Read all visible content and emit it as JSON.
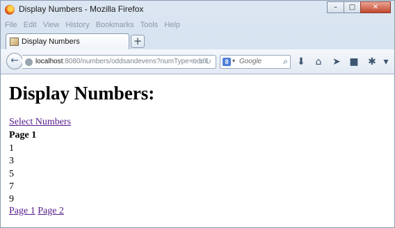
{
  "window": {
    "title": "Display Numbers - Mozilla Firefox",
    "controls": {
      "minimize": "–",
      "maximize": "□",
      "close": "✕"
    }
  },
  "menu": [
    "File",
    "Edit",
    "View",
    "History",
    "Bookmarks",
    "Tools",
    "Help"
  ],
  "tab": {
    "title": "Display Numbers",
    "new_tab": "+"
  },
  "navbar": {
    "back_icon": "←",
    "url_host": "localhost",
    "url_rest": ":8080/numbers/oddsandevens?numType=odds",
    "url_icons": "☆▿↻",
    "search_engine": "8",
    "search_dropdown": "▾",
    "search_placeholder": "Google",
    "search_icon": "⌕",
    "download_icon": "⬇",
    "home_icon": "⌂",
    "send_icon": "➤",
    "pocket_icon": "■",
    "extension_icon": "✱",
    "menu_icon": "▾"
  },
  "page": {
    "heading": "Display Numbers:",
    "select_link": "Select Numbers",
    "page_label": "Page 1",
    "numbers": [
      "1",
      "3",
      "5",
      "7",
      "9"
    ],
    "pager": [
      "Page 1",
      "Page 2"
    ]
  }
}
